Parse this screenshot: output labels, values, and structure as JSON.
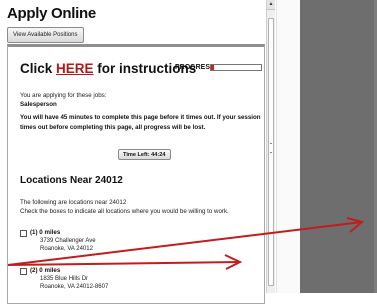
{
  "app": {
    "title": "Apply Online"
  },
  "toolbar": {
    "view_positions": "View Available Positions"
  },
  "header": {
    "click": "Click ",
    "here": "HERE",
    "rest": " for instructions",
    "progress_label": "PROGRESS:",
    "progress_value": 0.05,
    "progress_color": "#c62020"
  },
  "jobs": {
    "intro": "You are applying for these jobs:",
    "title": "Salesperson"
  },
  "timeout": {
    "line1": "You will have 45 minutes to complete this page before it times out. If your session",
    "line2": "times out before completing this page, all progress will be lost."
  },
  "timer": {
    "label": "Time Left: 44:24"
  },
  "locations": {
    "title": "Locations Near 24012",
    "desc1": "The following are locations near 24012",
    "desc2": "Check the boxes to indicate all locations where you would be willing to work.",
    "items": [
      {
        "num": "(1)",
        "distance": "0 miles",
        "street": "3739 Challenger Ave",
        "city": "Roanoke, VA  24012"
      },
      {
        "num": "(2)",
        "distance": "0 miles",
        "street": "1835 Blue Hills Dr",
        "city": "Roanoke, VA  24012-8607"
      }
    ]
  },
  "annotations": {
    "arrow_color": "#c11d1d"
  }
}
